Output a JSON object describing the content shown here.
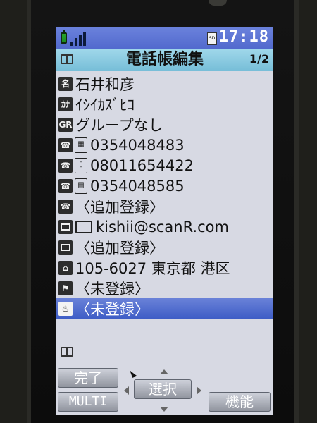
{
  "status": {
    "clock": "17:18",
    "sd_label": "SD"
  },
  "title_bar": {
    "title": "電話帳編集",
    "page": "1/2"
  },
  "entries": [
    {
      "icon": "名",
      "text": "石井和彦"
    },
    {
      "icon": "ｶﾅ",
      "text": "ｲｼｲｶｽﾞﾋｺ"
    },
    {
      "icon": "GR",
      "text": "グループなし"
    },
    {
      "icon": "phone-home",
      "text": "0354048483"
    },
    {
      "icon": "phone-mobile",
      "text": "08011654422"
    },
    {
      "icon": "phone-fax",
      "text": "0354048585"
    },
    {
      "icon": "phone",
      "text": "〈追加登録〉"
    },
    {
      "icon": "mail",
      "text": "kishii@scanR.com"
    },
    {
      "icon": "mail",
      "text": "〈追加登録〉"
    },
    {
      "icon": "house",
      "text": "105-6027 東京都 港区"
    },
    {
      "icon": "flag",
      "text": "〈未登録〉"
    },
    {
      "icon": "cake",
      "text": "〈未登録〉",
      "selected": true
    }
  ],
  "softkeys": {
    "complete": "完了",
    "select": "選択",
    "multi": "MULTI",
    "function": "機能"
  },
  "colors": {
    "status_blue": "#5169cd",
    "title_cyan": "#77bed8",
    "selection_blue": "#3e5dc6",
    "screen_bg": "#d7d9e3"
  }
}
